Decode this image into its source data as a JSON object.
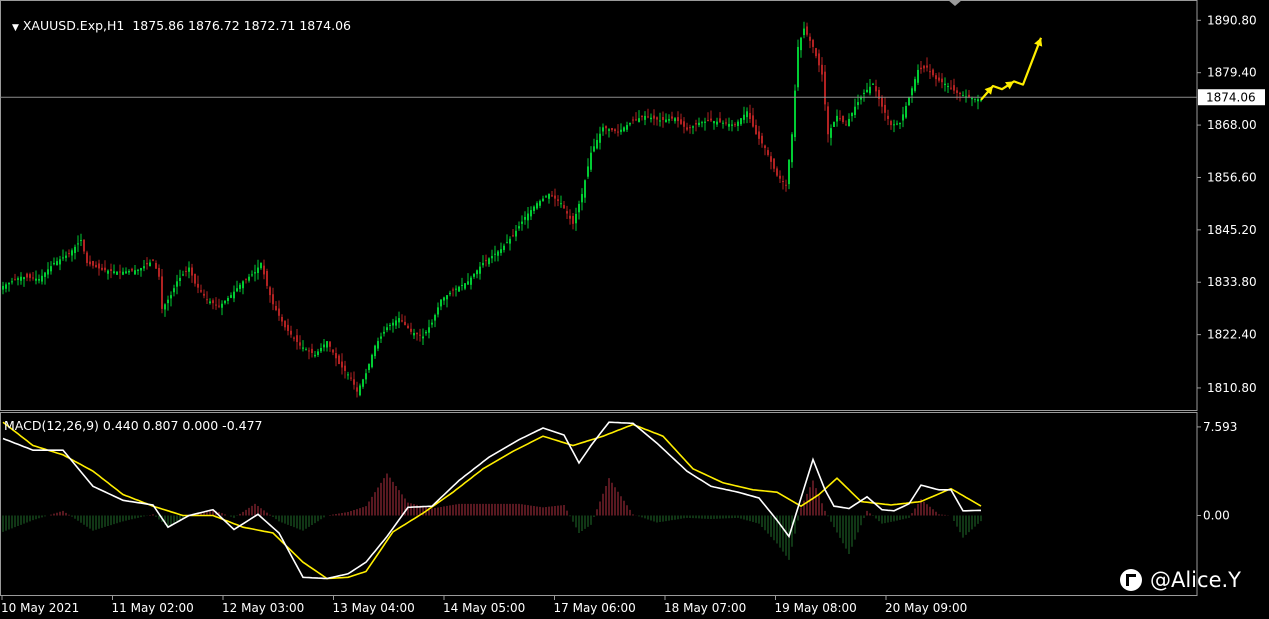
{
  "header": {
    "symbol": "XAUUSD.Exp,H1",
    "ohlc": "1875.86 1876.72 1872.71 1874.06"
  },
  "macd_panel": {
    "title": "MACD(12,26,9) 0.440 0.807 0.000 -0.477"
  },
  "watermark": {
    "text": "@Alice.Y"
  },
  "colors": {
    "background": "#000000",
    "bull_candle": "#00cc33",
    "bear_candle": "#b22222",
    "grid": "#9a9a9a",
    "price_line": "#8c8c8c",
    "macd_main": "#ffffff",
    "macd_signal": "#ffee00",
    "hist_positive": "#b03040",
    "hist_negative": "#1f6b2a",
    "arrow": "#ffee00"
  },
  "chart_data": [
    {
      "type": "candlestick",
      "symbol": "XAUUSD.Exp",
      "timeframe": "H1",
      "y_ticks": [
        "1890.80",
        "1879.40",
        "1868.00",
        "1856.60",
        "1845.20",
        "1833.80",
        "1822.40",
        "1810.80"
      ],
      "ylim": [
        1806.0,
        1895.0
      ],
      "current_price": "1874.06",
      "x_ticks": [
        "10 May 2021",
        "11 May 02:00",
        "12 May 03:00",
        "13 May 04:00",
        "14 May 05:00",
        "17 May 06:00",
        "18 May 07:00",
        "19 May 08:00",
        "20 May 09:00"
      ],
      "close_path": [
        {
          "x": 0,
          "y": 1833.0
        },
        {
          "x": 6,
          "y": 1835.0
        },
        {
          "x": 12,
          "y": 1834.5
        },
        {
          "x": 17,
          "y": 1838.0
        },
        {
          "x": 22,
          "y": 1840.0
        },
        {
          "x": 26,
          "y": 1843.0
        },
        {
          "x": 28,
          "y": 1838.0
        },
        {
          "x": 33,
          "y": 1836.5
        },
        {
          "x": 39,
          "y": 1836.0
        },
        {
          "x": 45,
          "y": 1836.5
        },
        {
          "x": 50,
          "y": 1838.5
        },
        {
          "x": 52,
          "y": 1835.0
        },
        {
          "x": 53,
          "y": 1828.0
        },
        {
          "x": 56,
          "y": 1831.0
        },
        {
          "x": 58,
          "y": 1834.0
        },
        {
          "x": 62,
          "y": 1837.0
        },
        {
          "x": 64,
          "y": 1833.5
        },
        {
          "x": 68,
          "y": 1830.0
        },
        {
          "x": 72,
          "y": 1828.5
        },
        {
          "x": 76,
          "y": 1831.0
        },
        {
          "x": 80,
          "y": 1834.0
        },
        {
          "x": 84,
          "y": 1836.0
        },
        {
          "x": 86,
          "y": 1838.0
        },
        {
          "x": 88,
          "y": 1833.0
        },
        {
          "x": 90,
          "y": 1829.0
        },
        {
          "x": 94,
          "y": 1824.0
        },
        {
          "x": 99,
          "y": 1820.0
        },
        {
          "x": 104,
          "y": 1818.0
        },
        {
          "x": 108,
          "y": 1821.0
        },
        {
          "x": 112,
          "y": 1816.0
        },
        {
          "x": 116,
          "y": 1813.0
        },
        {
          "x": 118,
          "y": 1810.0
        },
        {
          "x": 121,
          "y": 1814.0
        },
        {
          "x": 124,
          "y": 1820.0
        },
        {
          "x": 128,
          "y": 1824.0
        },
        {
          "x": 132,
          "y": 1826.0
        },
        {
          "x": 136,
          "y": 1823.0
        },
        {
          "x": 140,
          "y": 1822.0
        },
        {
          "x": 143,
          "y": 1825.0
        },
        {
          "x": 146,
          "y": 1830.0
        },
        {
          "x": 150,
          "y": 1832.0
        },
        {
          "x": 155,
          "y": 1834.0
        },
        {
          "x": 160,
          "y": 1838.0
        },
        {
          "x": 166,
          "y": 1841.0
        },
        {
          "x": 170,
          "y": 1844.0
        },
        {
          "x": 174,
          "y": 1848.0
        },
        {
          "x": 178,
          "y": 1851.0
        },
        {
          "x": 182,
          "y": 1853.0
        },
        {
          "x": 186,
          "y": 1851.0
        },
        {
          "x": 190,
          "y": 1846.5
        },
        {
          "x": 193,
          "y": 1853.0
        },
        {
          "x": 196,
          "y": 1862.0
        },
        {
          "x": 200,
          "y": 1867.5
        },
        {
          "x": 205,
          "y": 1866.5
        },
        {
          "x": 210,
          "y": 1869.0
        },
        {
          "x": 214,
          "y": 1870.0
        },
        {
          "x": 219,
          "y": 1869.0
        },
        {
          "x": 224,
          "y": 1869.5
        },
        {
          "x": 228,
          "y": 1867.0
        },
        {
          "x": 232,
          "y": 1868.5
        },
        {
          "x": 236,
          "y": 1869.0
        },
        {
          "x": 240,
          "y": 1868.5
        },
        {
          "x": 244,
          "y": 1868.0
        },
        {
          "x": 248,
          "y": 1871.0
        },
        {
          "x": 251,
          "y": 1866.0
        },
        {
          "x": 254,
          "y": 1863.0
        },
        {
          "x": 258,
          "y": 1857.0
        },
        {
          "x": 261,
          "y": 1855.0
        },
        {
          "x": 263,
          "y": 1866.0
        },
        {
          "x": 265,
          "y": 1885.0
        },
        {
          "x": 267,
          "y": 1889.0
        },
        {
          "x": 270,
          "y": 1885.0
        },
        {
          "x": 273,
          "y": 1879.0
        },
        {
          "x": 275,
          "y": 1866.0
        },
        {
          "x": 278,
          "y": 1870.0
        },
        {
          "x": 281,
          "y": 1868.0
        },
        {
          "x": 284,
          "y": 1872.0
        },
        {
          "x": 287,
          "y": 1875.0
        },
        {
          "x": 290,
          "y": 1877.0
        },
        {
          "x": 293,
          "y": 1872.0
        },
        {
          "x": 296,
          "y": 1868.0
        },
        {
          "x": 299,
          "y": 1868.5
        },
        {
          "x": 302,
          "y": 1874.0
        },
        {
          "x": 305,
          "y": 1880.0
        },
        {
          "x": 308,
          "y": 1880.5
        },
        {
          "x": 311,
          "y": 1878.0
        },
        {
          "x": 314,
          "y": 1877.0
        },
        {
          "x": 318,
          "y": 1875.0
        },
        {
          "x": 322,
          "y": 1874.0
        },
        {
          "x": 326,
          "y": 1873.5
        }
      ],
      "macd": {
        "name": "MACD(12,26,9)",
        "ylim": [
          -6.9,
          8.7
        ],
        "y_ticks": [
          "7.593",
          "0.00"
        ],
        "values": [
          "0.440",
          "0.807",
          "0.000",
          "-0.477"
        ],
        "main_path": [
          {
            "x": 0,
            "y": 6.6
          },
          {
            "x": 10,
            "y": 5.6
          },
          {
            "x": 20,
            "y": 5.6
          },
          {
            "x": 30,
            "y": 2.5
          },
          {
            "x": 40,
            "y": 1.3
          },
          {
            "x": 50,
            "y": 0.9
          },
          {
            "x": 55,
            "y": -1.0
          },
          {
            "x": 62,
            "y": 0.0
          },
          {
            "x": 70,
            "y": 0.5
          },
          {
            "x": 77,
            "y": -1.2
          },
          {
            "x": 85,
            "y": 0.1
          },
          {
            "x": 92,
            "y": -1.5
          },
          {
            "x": 100,
            "y": -5.3
          },
          {
            "x": 108,
            "y": -5.4
          },
          {
            "x": 115,
            "y": -5.0
          },
          {
            "x": 121,
            "y": -4.0
          },
          {
            "x": 128,
            "y": -1.8
          },
          {
            "x": 135,
            "y": 0.7
          },
          {
            "x": 143,
            "y": 0.8
          },
          {
            "x": 152,
            "y": 3.0
          },
          {
            "x": 162,
            "y": 5.0
          },
          {
            "x": 172,
            "y": 6.5
          },
          {
            "x": 180,
            "y": 7.5
          },
          {
            "x": 187,
            "y": 6.9
          },
          {
            "x": 192,
            "y": 4.5
          },
          {
            "x": 196,
            "y": 6.0
          },
          {
            "x": 202,
            "y": 8.0
          },
          {
            "x": 210,
            "y": 7.9
          },
          {
            "x": 218,
            "y": 6.2
          },
          {
            "x": 228,
            "y": 3.8
          },
          {
            "x": 236,
            "y": 2.5
          },
          {
            "x": 245,
            "y": 2.0
          },
          {
            "x": 252,
            "y": 1.5
          },
          {
            "x": 258,
            "y": -0.4
          },
          {
            "x": 262,
            "y": -1.8
          },
          {
            "x": 266,
            "y": 1.5
          },
          {
            "x": 270,
            "y": 4.8
          },
          {
            "x": 274,
            "y": 2.2
          },
          {
            "x": 277,
            "y": 0.8
          },
          {
            "x": 282,
            "y": 0.6
          },
          {
            "x": 288,
            "y": 1.6
          },
          {
            "x": 293,
            "y": 0.5
          },
          {
            "x": 297,
            "y": 0.4
          },
          {
            "x": 302,
            "y": 1.0
          },
          {
            "x": 306,
            "y": 2.6
          },
          {
            "x": 312,
            "y": 2.2
          },
          {
            "x": 316,
            "y": 2.2
          },
          {
            "x": 320,
            "y": 0.4
          },
          {
            "x": 326,
            "y": 0.44
          }
        ],
        "signal_path": [
          {
            "x": 0,
            "y": 8.0
          },
          {
            "x": 10,
            "y": 6.0
          },
          {
            "x": 20,
            "y": 5.2
          },
          {
            "x": 30,
            "y": 3.8
          },
          {
            "x": 40,
            "y": 1.8
          },
          {
            "x": 50,
            "y": 0.8
          },
          {
            "x": 60,
            "y": 0.0
          },
          {
            "x": 70,
            "y": 0.0
          },
          {
            "x": 80,
            "y": -1.0
          },
          {
            "x": 90,
            "y": -1.5
          },
          {
            "x": 100,
            "y": -4.0
          },
          {
            "x": 108,
            "y": -5.4
          },
          {
            "x": 115,
            "y": -5.3
          },
          {
            "x": 121,
            "y": -4.8
          },
          {
            "x": 130,
            "y": -1.4
          },
          {
            "x": 140,
            "y": 0.2
          },
          {
            "x": 150,
            "y": 2.0
          },
          {
            "x": 160,
            "y": 4.0
          },
          {
            "x": 170,
            "y": 5.5
          },
          {
            "x": 180,
            "y": 6.8
          },
          {
            "x": 190,
            "y": 6.0
          },
          {
            "x": 200,
            "y": 6.8
          },
          {
            "x": 210,
            "y": 7.8
          },
          {
            "x": 220,
            "y": 6.8
          },
          {
            "x": 230,
            "y": 4.0
          },
          {
            "x": 240,
            "y": 2.8
          },
          {
            "x": 250,
            "y": 2.2
          },
          {
            "x": 258,
            "y": 2.0
          },
          {
            "x": 266,
            "y": 0.8
          },
          {
            "x": 272,
            "y": 1.8
          },
          {
            "x": 278,
            "y": 3.2
          },
          {
            "x": 286,
            "y": 1.2
          },
          {
            "x": 296,
            "y": 0.9
          },
          {
            "x": 306,
            "y": 1.2
          },
          {
            "x": 316,
            "y": 2.3
          },
          {
            "x": 326,
            "y": 0.81
          }
        ],
        "histogram_path": [
          {
            "x": 0,
            "y": -1.4
          },
          {
            "x": 10,
            "y": -0.4
          },
          {
            "x": 20,
            "y": 0.4
          },
          {
            "x": 30,
            "y": -1.3
          },
          {
            "x": 40,
            "y": -0.5
          },
          {
            "x": 50,
            "y": 0.1
          },
          {
            "x": 55,
            "y": -1.0
          },
          {
            "x": 62,
            "y": 0.0
          },
          {
            "x": 70,
            "y": 0.5
          },
          {
            "x": 77,
            "y": -0.2
          },
          {
            "x": 84,
            "y": 1.0
          },
          {
            "x": 92,
            "y": -0.5
          },
          {
            "x": 100,
            "y": -1.3
          },
          {
            "x": 108,
            "y": 0.0
          },
          {
            "x": 115,
            "y": 0.3
          },
          {
            "x": 121,
            "y": 0.8
          },
          {
            "x": 128,
            "y": 3.6
          },
          {
            "x": 135,
            "y": 1.1
          },
          {
            "x": 143,
            "y": 0.6
          },
          {
            "x": 152,
            "y": 1.0
          },
          {
            "x": 162,
            "y": 1.0
          },
          {
            "x": 172,
            "y": 1.0
          },
          {
            "x": 180,
            "y": 0.7
          },
          {
            "x": 187,
            "y": 0.9
          },
          {
            "x": 192,
            "y": -1.5
          },
          {
            "x": 196,
            "y": -0.8
          },
          {
            "x": 202,
            "y": 3.2
          },
          {
            "x": 210,
            "y": 0.1
          },
          {
            "x": 218,
            "y": -0.6
          },
          {
            "x": 228,
            "y": -0.2
          },
          {
            "x": 236,
            "y": -0.3
          },
          {
            "x": 245,
            "y": -0.2
          },
          {
            "x": 252,
            "y": -0.7
          },
          {
            "x": 258,
            "y": -2.4
          },
          {
            "x": 262,
            "y": -3.8
          },
          {
            "x": 266,
            "y": 0.7
          },
          {
            "x": 270,
            "y": 3.0
          },
          {
            "x": 274,
            "y": 0.4
          },
          {
            "x": 277,
            "y": -1.0
          },
          {
            "x": 282,
            "y": -3.3
          },
          {
            "x": 288,
            "y": 0.4
          },
          {
            "x": 293,
            "y": -0.7
          },
          {
            "x": 297,
            "y": -0.5
          },
          {
            "x": 302,
            "y": -0.2
          },
          {
            "x": 306,
            "y": 1.4
          },
          {
            "x": 312,
            "y": 0.1
          },
          {
            "x": 316,
            "y": 0.0
          },
          {
            "x": 320,
            "y": -1.9
          },
          {
            "x": 326,
            "y": -0.48
          }
        ]
      },
      "annotation": {
        "type": "projected-path-arrows",
        "points": [
          {
            "x": 326,
            "y": 1873.5
          },
          {
            "x": 330,
            "y": 1876.5
          },
          {
            "x": 333,
            "y": 1875.8
          },
          {
            "x": 337,
            "y": 1877.5
          },
          {
            "x": 340,
            "y": 1876.8
          },
          {
            "x": 346,
            "y": 1887.0
          }
        ]
      }
    }
  ]
}
